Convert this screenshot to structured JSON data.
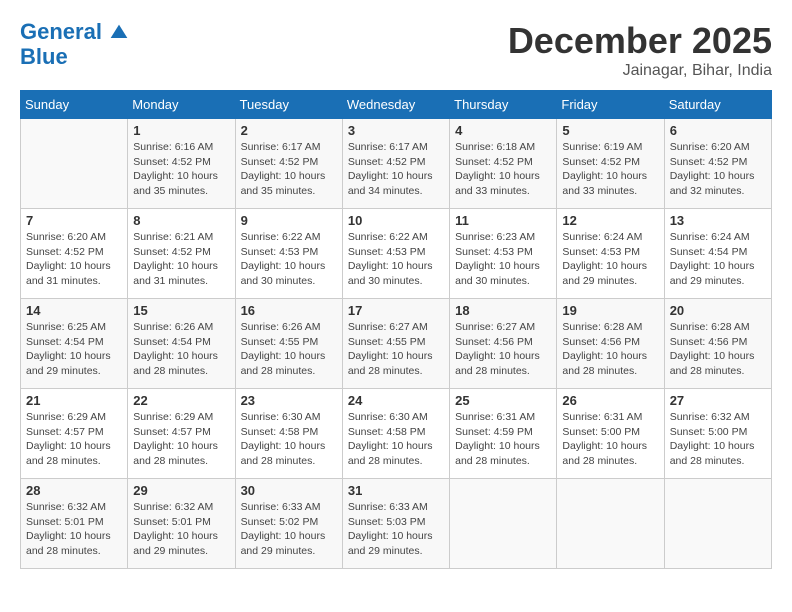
{
  "header": {
    "logo_line1": "General",
    "logo_line2": "Blue",
    "month": "December 2025",
    "location": "Jainagar, Bihar, India"
  },
  "days_of_week": [
    "Sunday",
    "Monday",
    "Tuesday",
    "Wednesday",
    "Thursday",
    "Friday",
    "Saturday"
  ],
  "weeks": [
    [
      {
        "day": "",
        "sunrise": "",
        "sunset": "",
        "daylight": ""
      },
      {
        "day": "1",
        "sunrise": "Sunrise: 6:16 AM",
        "sunset": "Sunset: 4:52 PM",
        "daylight": "Daylight: 10 hours and 35 minutes."
      },
      {
        "day": "2",
        "sunrise": "Sunrise: 6:17 AM",
        "sunset": "Sunset: 4:52 PM",
        "daylight": "Daylight: 10 hours and 35 minutes."
      },
      {
        "day": "3",
        "sunrise": "Sunrise: 6:17 AM",
        "sunset": "Sunset: 4:52 PM",
        "daylight": "Daylight: 10 hours and 34 minutes."
      },
      {
        "day": "4",
        "sunrise": "Sunrise: 6:18 AM",
        "sunset": "Sunset: 4:52 PM",
        "daylight": "Daylight: 10 hours and 33 minutes."
      },
      {
        "day": "5",
        "sunrise": "Sunrise: 6:19 AM",
        "sunset": "Sunset: 4:52 PM",
        "daylight": "Daylight: 10 hours and 33 minutes."
      },
      {
        "day": "6",
        "sunrise": "Sunrise: 6:20 AM",
        "sunset": "Sunset: 4:52 PM",
        "daylight": "Daylight: 10 hours and 32 minutes."
      }
    ],
    [
      {
        "day": "7",
        "sunrise": "Sunrise: 6:20 AM",
        "sunset": "Sunset: 4:52 PM",
        "daylight": "Daylight: 10 hours and 31 minutes."
      },
      {
        "day": "8",
        "sunrise": "Sunrise: 6:21 AM",
        "sunset": "Sunset: 4:52 PM",
        "daylight": "Daylight: 10 hours and 31 minutes."
      },
      {
        "day": "9",
        "sunrise": "Sunrise: 6:22 AM",
        "sunset": "Sunset: 4:53 PM",
        "daylight": "Daylight: 10 hours and 30 minutes."
      },
      {
        "day": "10",
        "sunrise": "Sunrise: 6:22 AM",
        "sunset": "Sunset: 4:53 PM",
        "daylight": "Daylight: 10 hours and 30 minutes."
      },
      {
        "day": "11",
        "sunrise": "Sunrise: 6:23 AM",
        "sunset": "Sunset: 4:53 PM",
        "daylight": "Daylight: 10 hours and 30 minutes."
      },
      {
        "day": "12",
        "sunrise": "Sunrise: 6:24 AM",
        "sunset": "Sunset: 4:53 PM",
        "daylight": "Daylight: 10 hours and 29 minutes."
      },
      {
        "day": "13",
        "sunrise": "Sunrise: 6:24 AM",
        "sunset": "Sunset: 4:54 PM",
        "daylight": "Daylight: 10 hours and 29 minutes."
      }
    ],
    [
      {
        "day": "14",
        "sunrise": "Sunrise: 6:25 AM",
        "sunset": "Sunset: 4:54 PM",
        "daylight": "Daylight: 10 hours and 29 minutes."
      },
      {
        "day": "15",
        "sunrise": "Sunrise: 6:26 AM",
        "sunset": "Sunset: 4:54 PM",
        "daylight": "Daylight: 10 hours and 28 minutes."
      },
      {
        "day": "16",
        "sunrise": "Sunrise: 6:26 AM",
        "sunset": "Sunset: 4:55 PM",
        "daylight": "Daylight: 10 hours and 28 minutes."
      },
      {
        "day": "17",
        "sunrise": "Sunrise: 6:27 AM",
        "sunset": "Sunset: 4:55 PM",
        "daylight": "Daylight: 10 hours and 28 minutes."
      },
      {
        "day": "18",
        "sunrise": "Sunrise: 6:27 AM",
        "sunset": "Sunset: 4:56 PM",
        "daylight": "Daylight: 10 hours and 28 minutes."
      },
      {
        "day": "19",
        "sunrise": "Sunrise: 6:28 AM",
        "sunset": "Sunset: 4:56 PM",
        "daylight": "Daylight: 10 hours and 28 minutes."
      },
      {
        "day": "20",
        "sunrise": "Sunrise: 6:28 AM",
        "sunset": "Sunset: 4:56 PM",
        "daylight": "Daylight: 10 hours and 28 minutes."
      }
    ],
    [
      {
        "day": "21",
        "sunrise": "Sunrise: 6:29 AM",
        "sunset": "Sunset: 4:57 PM",
        "daylight": "Daylight: 10 hours and 28 minutes."
      },
      {
        "day": "22",
        "sunrise": "Sunrise: 6:29 AM",
        "sunset": "Sunset: 4:57 PM",
        "daylight": "Daylight: 10 hours and 28 minutes."
      },
      {
        "day": "23",
        "sunrise": "Sunrise: 6:30 AM",
        "sunset": "Sunset: 4:58 PM",
        "daylight": "Daylight: 10 hours and 28 minutes."
      },
      {
        "day": "24",
        "sunrise": "Sunrise: 6:30 AM",
        "sunset": "Sunset: 4:58 PM",
        "daylight": "Daylight: 10 hours and 28 minutes."
      },
      {
        "day": "25",
        "sunrise": "Sunrise: 6:31 AM",
        "sunset": "Sunset: 4:59 PM",
        "daylight": "Daylight: 10 hours and 28 minutes."
      },
      {
        "day": "26",
        "sunrise": "Sunrise: 6:31 AM",
        "sunset": "Sunset: 5:00 PM",
        "daylight": "Daylight: 10 hours and 28 minutes."
      },
      {
        "day": "27",
        "sunrise": "Sunrise: 6:32 AM",
        "sunset": "Sunset: 5:00 PM",
        "daylight": "Daylight: 10 hours and 28 minutes."
      }
    ],
    [
      {
        "day": "28",
        "sunrise": "Sunrise: 6:32 AM",
        "sunset": "Sunset: 5:01 PM",
        "daylight": "Daylight: 10 hours and 28 minutes."
      },
      {
        "day": "29",
        "sunrise": "Sunrise: 6:32 AM",
        "sunset": "Sunset: 5:01 PM",
        "daylight": "Daylight: 10 hours and 29 minutes."
      },
      {
        "day": "30",
        "sunrise": "Sunrise: 6:33 AM",
        "sunset": "Sunset: 5:02 PM",
        "daylight": "Daylight: 10 hours and 29 minutes."
      },
      {
        "day": "31",
        "sunrise": "Sunrise: 6:33 AM",
        "sunset": "Sunset: 5:03 PM",
        "daylight": "Daylight: 10 hours and 29 minutes."
      },
      {
        "day": "",
        "sunrise": "",
        "sunset": "",
        "daylight": ""
      },
      {
        "day": "",
        "sunrise": "",
        "sunset": "",
        "daylight": ""
      },
      {
        "day": "",
        "sunrise": "",
        "sunset": "",
        "daylight": ""
      }
    ]
  ]
}
